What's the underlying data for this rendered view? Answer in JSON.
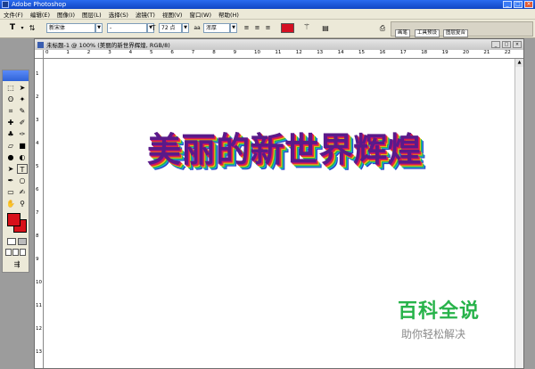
{
  "app": {
    "title": "Adobe Photoshop"
  },
  "menu": [
    "文件(F)",
    "编辑(E)",
    "图像(I)",
    "图层(L)",
    "选择(S)",
    "滤镜(T)",
    "视图(V)",
    "窗口(W)",
    "帮助(H)"
  ],
  "options": {
    "tool_glyph": "T",
    "font_family": "新宋体",
    "font_style": "-",
    "font_size": "72 点",
    "antialias": "浑厚",
    "text_color": "#d40f22"
  },
  "palette_tabs": [
    "画笔",
    "工具预设",
    "图层复合"
  ],
  "document": {
    "title": "未标题-1 @ 100% (美丽的新世界辉煌, RGB/8)",
    "canvas_text": "美丽的新世界辉煌",
    "ruler_top": [
      "0",
      "1",
      "2",
      "3",
      "4",
      "5",
      "6",
      "7",
      "8",
      "9",
      "10",
      "11",
      "12",
      "13",
      "14",
      "15",
      "16",
      "17",
      "18",
      "19",
      "20",
      "21",
      "22"
    ],
    "ruler_left": [
      "1",
      "2",
      "3",
      "4",
      "5",
      "6",
      "7",
      "8",
      "9",
      "10",
      "11",
      "12",
      "13"
    ]
  },
  "colors": {
    "foreground": "#d8101a",
    "background": "#d8101a"
  },
  "watermark": {
    "title": "百科全说",
    "subtitle": "助你轻松解决"
  }
}
